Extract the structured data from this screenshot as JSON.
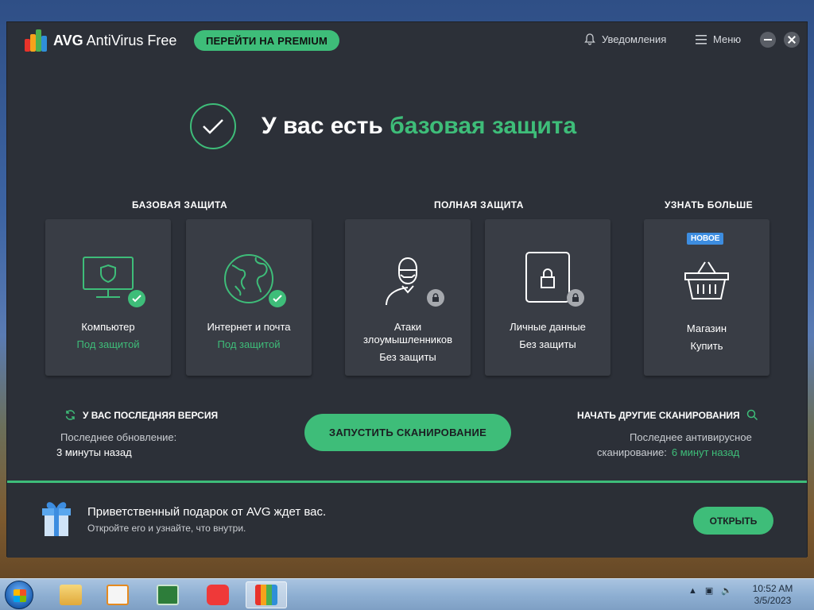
{
  "app": {
    "brand": "AVG",
    "product": "AntiVirus Free",
    "premium_button": "ПЕРЕЙТИ НА PREMIUM",
    "notifications": "Уведомления",
    "menu": "Меню"
  },
  "hero": {
    "title_prefix": "У вас есть",
    "title_highlight": "базовая защита"
  },
  "sections": {
    "basic": "БАЗОВАЯ ЗАЩИТА",
    "full": "ПОЛНАЯ ЗАЩИТА",
    "learn_more": "УЗНАТЬ БОЛЬШЕ"
  },
  "cards": [
    {
      "title": "Компьютер",
      "status": "Под защитой",
      "icon": "monitor-shield-icon"
    },
    {
      "title": "Интернет и почта",
      "status": "Под защитой",
      "icon": "globe-icon"
    },
    {
      "title": "Атаки злоумышленников",
      "status": "Без защиты",
      "icon": "hacker-icon"
    },
    {
      "title": "Личные данные",
      "status": "Без защиты",
      "icon": "padlock-icon"
    },
    {
      "title": "Магазин",
      "status": "Купить",
      "badge": "НОВОЕ",
      "icon": "basket-icon"
    }
  ],
  "update": {
    "heading": "У ВАС ПОСЛЕДНЯЯ ВЕРСИЯ",
    "label": "Последнее обновление:",
    "value": "3 минуты назад"
  },
  "scan": {
    "button": "ЗАПУСТИТЬ СКАНИРОВАНИЕ"
  },
  "other_scans": {
    "heading": "НАЧАТЬ ДРУГИЕ СКАНИРОВАНИЯ",
    "line1": "Последнее антивирусное",
    "line2_label": "сканирование:",
    "line2_value": "6 минут назад"
  },
  "gift": {
    "title": "Приветственный подарок от AVG ждет вас.",
    "subtitle": "Откройте его и узнайте, что внутри.",
    "button": "ОТКРЫТЬ"
  },
  "taskbar": {
    "time": "10:52 AM",
    "date": "3/5/2023"
  },
  "colors": {
    "accent": "#3ebd79",
    "window_bg": "#2c3038",
    "card_bg": "#393d45",
    "badge_blue": "#3d8de0"
  }
}
